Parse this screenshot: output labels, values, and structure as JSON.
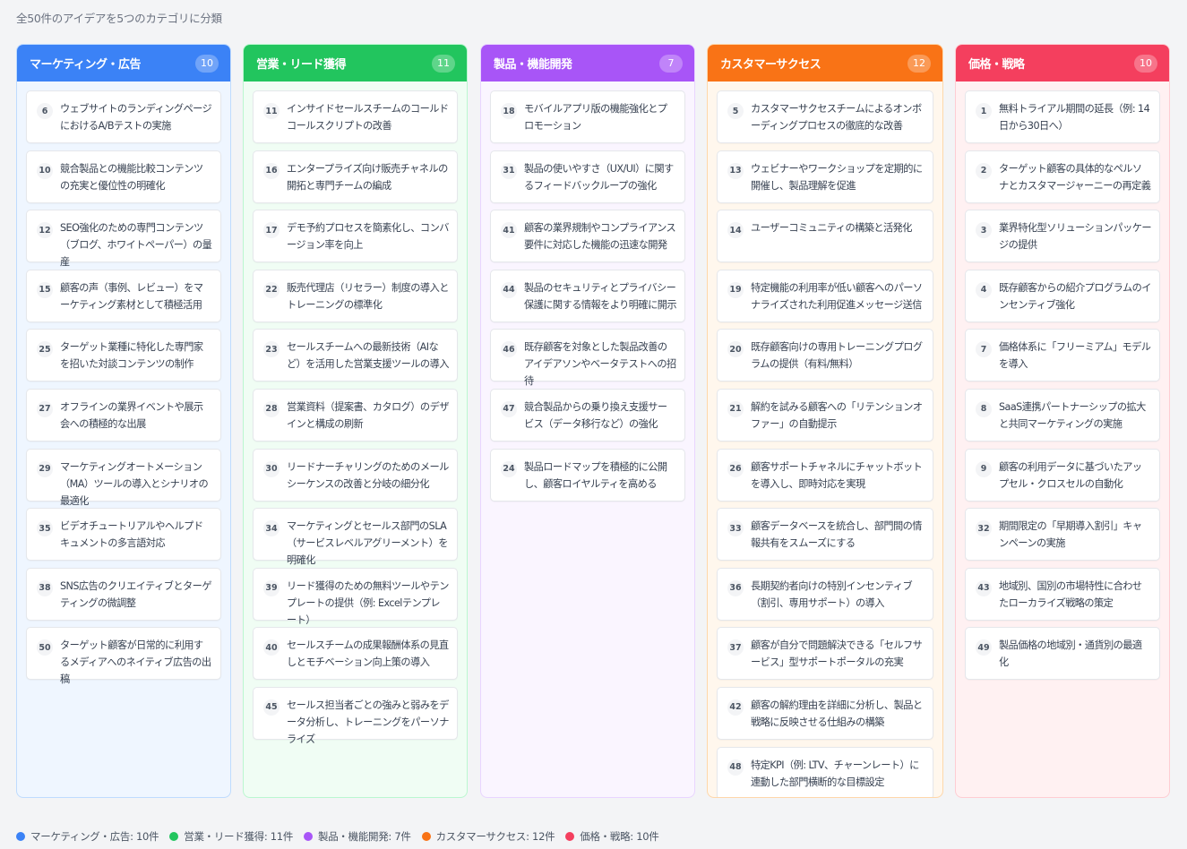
{
  "summary": "全50件のアイデアを5つのカテゴリに分類",
  "colors": {
    "marketing": "#3b82f6",
    "sales": "#22c55e",
    "product": "#a855f7",
    "success": "#f97316",
    "pricing": "#f43f5e"
  },
  "columns": [
    {
      "title": "マーケティング・広告",
      "count": "10",
      "cards": [
        {
          "num": "6",
          "text": "ウェブサイトのランディングページにおけるA/Bテストの実施"
        },
        {
          "num": "10",
          "text": "競合製品との機能比較コンテンツの充実と優位性の明確化"
        },
        {
          "num": "12",
          "text": "SEO強化のための専門コンテンツ（ブログ、ホワイトペーパー）の量産"
        },
        {
          "num": "15",
          "text": "顧客の声（事例、レビュー）をマーケティング素材として積極活用"
        },
        {
          "num": "25",
          "text": "ターゲット業種に特化した専門家を招いた対談コンテンツの制作"
        },
        {
          "num": "27",
          "text": "オフラインの業界イベントや展示会への積極的な出展"
        },
        {
          "num": "29",
          "text": "マーケティングオートメーション（MA）ツールの導入とシナリオの最適化"
        },
        {
          "num": "35",
          "text": "ビデオチュートリアルやヘルプドキュメントの多言語対応"
        },
        {
          "num": "38",
          "text": "SNS広告のクリエイティブとターゲティングの微調整"
        },
        {
          "num": "50",
          "text": "ターゲット顧客が日常的に利用するメディアへのネイティブ広告の出稿"
        }
      ]
    },
    {
      "title": "営業・リード獲得",
      "count": "11",
      "cards": [
        {
          "num": "11",
          "text": "インサイドセールスチームのコールドコールスクリプトの改善"
        },
        {
          "num": "16",
          "text": "エンタープライズ向け販売チャネルの開拓と専門チームの編成"
        },
        {
          "num": "17",
          "text": "デモ予約プロセスを簡素化し、コンバージョン率を向上"
        },
        {
          "num": "22",
          "text": "販売代理店（リセラー）制度の導入とトレーニングの標準化"
        },
        {
          "num": "23",
          "text": "セールスチームへの最新技術（AIなど）を活用した営業支援ツールの導入"
        },
        {
          "num": "28",
          "text": "営業資料（提案書、カタログ）のデザインと構成の刷新"
        },
        {
          "num": "30",
          "text": "リードナーチャリングのためのメールシーケンスの改善と分岐の細分化"
        },
        {
          "num": "34",
          "text": "マーケティングとセールス部門のSLA（サービスレベルアグリーメント）を明確化"
        },
        {
          "num": "39",
          "text": "リード獲得のための無料ツールやテンプレートの提供（例: Excelテンプレート）"
        },
        {
          "num": "40",
          "text": "セールスチームの成果報酬体系の見直しとモチベーション向上策の導入"
        },
        {
          "num": "45",
          "text": "セールス担当者ごとの強みと弱みをデータ分析し、トレーニングをパーソナライズ"
        }
      ]
    },
    {
      "title": "製品・機能開発",
      "count": "7",
      "cards": [
        {
          "num": "18",
          "text": "モバイルアプリ版の機能強化とプロモーション"
        },
        {
          "num": "31",
          "text": "製品の使いやすさ（UX/UI）に関するフィードバックループの強化"
        },
        {
          "num": "41",
          "text": "顧客の業界規制やコンプライアンス要件に対応した機能の迅速な開発"
        },
        {
          "num": "44",
          "text": "製品のセキュリティとプライバシー保護に関する情報をより明確に開示"
        },
        {
          "num": "46",
          "text": "既存顧客を対象とした製品改善のアイデアソンやベータテストへの招待"
        },
        {
          "num": "47",
          "text": "競合製品からの乗り換え支援サービス（データ移行など）の強化"
        },
        {
          "num": "24",
          "text": "製品ロードマップを積極的に公開し、顧客ロイヤルティを高める"
        }
      ]
    },
    {
      "title": "カスタマーサクセス",
      "count": "12",
      "cards": [
        {
          "num": "5",
          "text": "カスタマーサクセスチームによるオンボーディングプロセスの徹底的な改善"
        },
        {
          "num": "13",
          "text": "ウェビナーやワークショップを定期的に開催し、製品理解を促進"
        },
        {
          "num": "14",
          "text": "ユーザーコミュニティの構築と活発化"
        },
        {
          "num": "19",
          "text": "特定機能の利用率が低い顧客へのパーソナライズされた利用促進メッセージ送信"
        },
        {
          "num": "20",
          "text": "既存顧客向けの専用トレーニングプログラムの提供（有料/無料）"
        },
        {
          "num": "21",
          "text": "解約を試みる顧客への「リテンションオファー」の自動提示"
        },
        {
          "num": "26",
          "text": "顧客サポートチャネルにチャットボットを導入し、即時対応を実現"
        },
        {
          "num": "33",
          "text": "顧客データベースを統合し、部門間の情報共有をスムーズにする"
        },
        {
          "num": "36",
          "text": "長期契約者向けの特別インセンティブ（割引、専用サポート）の導入"
        },
        {
          "num": "37",
          "text": "顧客が自分で問題解決できる「セルフサービス」型サポートポータルの充実"
        },
        {
          "num": "42",
          "text": "顧客の解約理由を詳細に分析し、製品と戦略に反映させる仕組みの構築"
        },
        {
          "num": "48",
          "text": "特定KPI（例: LTV、チャーンレート）に連動した部門横断的な目標設定"
        }
      ]
    },
    {
      "title": "価格・戦略",
      "count": "10",
      "cards": [
        {
          "num": "1",
          "text": "無料トライアル期間の延長（例: 14日から30日へ）"
        },
        {
          "num": "2",
          "text": "ターゲット顧客の具体的なペルソナとカスタマージャーニーの再定義"
        },
        {
          "num": "3",
          "text": "業界特化型ソリューションパッケージの提供"
        },
        {
          "num": "4",
          "text": "既存顧客からの紹介プログラムのインセンティブ強化"
        },
        {
          "num": "7",
          "text": "価格体系に「フリーミアム」モデルを導入"
        },
        {
          "num": "8",
          "text": "SaaS連携パートナーシップの拡大と共同マーケティングの実施"
        },
        {
          "num": "9",
          "text": "顧客の利用データに基づいたアップセル・クロスセルの自動化"
        },
        {
          "num": "32",
          "text": "期間限定の「早期導入割引」キャンペーンの実施"
        },
        {
          "num": "43",
          "text": "地域別、国別の市場特性に合わせたローカライズ戦略の策定"
        },
        {
          "num": "49",
          "text": "製品価格の地域別・通貨別の最適化"
        }
      ]
    }
  ],
  "legend": [
    {
      "label": "マーケティング・広告: 10件"
    },
    {
      "label": "営業・リード獲得: 11件"
    },
    {
      "label": "製品・機能開発: 7件"
    },
    {
      "label": "カスタマーサクセス: 12件"
    },
    {
      "label": "価格・戦略: 10件"
    }
  ]
}
